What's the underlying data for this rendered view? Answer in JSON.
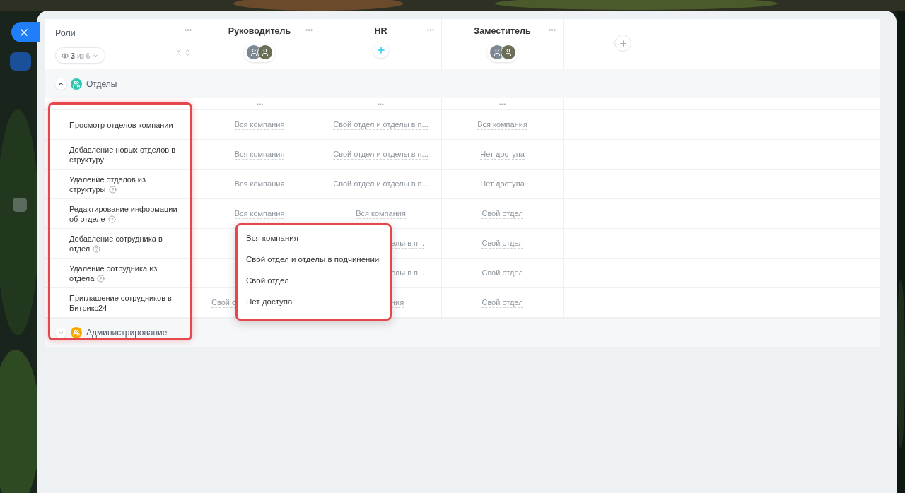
{
  "columns_header": {
    "title": "Роли",
    "visibility": "**3** из 6"
  },
  "roles": [
    {
      "name": "Руководитель",
      "kind": "avatars"
    },
    {
      "name": "HR",
      "kind": "add"
    },
    {
      "name": "Заместитель",
      "kind": "avatars"
    }
  ],
  "sections": [
    {
      "title": "Отделы",
      "expanded": true,
      "color": "#2fc6b0",
      "rows": [
        {
          "label": "Просмотр отделов компании",
          "help": false,
          "cells": [
            {
              "kind": "full",
              "value": "Вся компания"
            },
            {
              "kind": "full",
              "value": "Свой отдел и отделы в п..."
            },
            {
              "kind": "full",
              "value": "Вся компания"
            }
          ]
        },
        {
          "label": "Добавление новых отделов в структуру",
          "help": false,
          "cells": [
            {
              "kind": "full",
              "value": "Вся компания"
            },
            {
              "kind": "full",
              "value": "Свой отдел и отделы в п..."
            },
            {
              "kind": "full",
              "value": "Нет доступа"
            }
          ]
        },
        {
          "label": "Удаление отделов из структуры",
          "help": true,
          "cells": [
            {
              "kind": "full",
              "value": "Вся компания"
            },
            {
              "kind": "full",
              "value": "Свой отдел и отделы в п..."
            },
            {
              "kind": "full",
              "value": "Нет доступа"
            }
          ]
        },
        {
          "label": "Редактирование информации об отделе",
          "help": true,
          "cells": [
            {
              "kind": "full",
              "value": "Вся компания"
            },
            {
              "kind": "full",
              "value": "Вся компания"
            },
            {
              "kind": "full",
              "value": "Свой отдел"
            }
          ]
        },
        {
          "label": "Добавление сотрудника в отдел",
          "help": true,
          "cells": [
            {
              "kind": "hidden"
            },
            {
              "kind": "tail",
              "value": "елы в п..."
            },
            {
              "kind": "full",
              "value": "Свой отдел"
            }
          ]
        },
        {
          "label": "Удаление сотрудника из отдела",
          "help": true,
          "cells": [
            {
              "kind": "hidden"
            },
            {
              "kind": "tail",
              "value": "елы в п..."
            },
            {
              "kind": "full",
              "value": "Свой отдел"
            }
          ]
        },
        {
          "label": "Приглашение сотрудников в Битрикс24",
          "help": false,
          "cells": [
            {
              "kind": "head",
              "value": "Свой о"
            },
            {
              "kind": "tail",
              "value": "ния"
            },
            {
              "kind": "full",
              "value": "Свой отдел"
            }
          ]
        }
      ]
    },
    {
      "title": "Администрирование",
      "expanded": false,
      "color": "#f7a700"
    }
  ],
  "dropdown": {
    "options": [
      "Вся компания",
      "Свой отдел и отделы в подчинении",
      "Свой отдел",
      "Нет доступа"
    ]
  }
}
